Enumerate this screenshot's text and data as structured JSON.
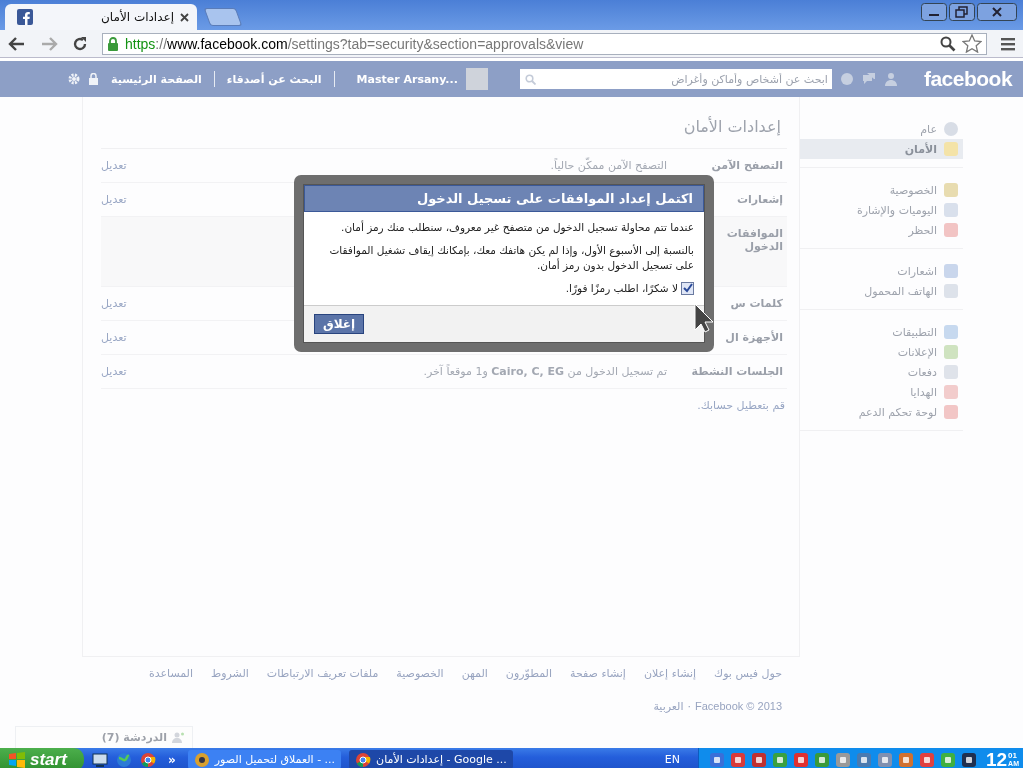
{
  "browser": {
    "tab": {
      "title": "إعدادات الأمان",
      "selected": true
    },
    "address": {
      "scheme": "https",
      "separator": "://",
      "host": "www.facebook.com",
      "path": "/settings?tab=security&section=approvals&view"
    }
  },
  "topbar": {
    "logo": "facebook",
    "search": {
      "placeholder": "ابحث عن أشخاص وأماكن وأغراض"
    },
    "user": "Master Arsany...",
    "links": [
      "البحث عن أصدقاء",
      "الصفحة الرئيسية"
    ]
  },
  "settings": {
    "title": "إعدادات الأمان",
    "rows": [
      {
        "label_lines": [
          "التصفح الآمن"
        ],
        "value": "التصفح الآمن ممكّن حالياً.",
        "action": "تعديل",
        "expanded": false
      },
      {
        "label_lines": [
          "إشعارات"
        ],
        "action": "تعديل",
        "expanded": false
      },
      {
        "label_lines": [
          "الموافقات",
          "الدخول"
        ],
        "expanded": true
      },
      {
        "label_lines": [
          "كلمات س"
        ],
        "action": "تعديل",
        "expanded": false
      },
      {
        "label_lines": [
          "الأجهزة ال"
        ],
        "action": "تعديل",
        "expanded": false
      },
      {
        "label_lines": [
          "الجلسات النشطة"
        ],
        "value": "تم تسجيل الدخول من **Cairo, C, EG** و1 موقعاً آخر.",
        "action": "تعديل",
        "expanded": false
      }
    ],
    "deactivate": "قم بتعطيل حسابك."
  },
  "sidebar": {
    "groups": [
      [
        {
          "label": "عام",
          "selected": false
        },
        {
          "label": "الأمان",
          "selected": true
        }
      ],
      [
        {
          "label": "الخصوصية",
          "selected": false
        },
        {
          "label": "اليوميات والإشارة",
          "selected": false
        },
        {
          "label": "الحظر",
          "selected": false
        }
      ],
      [
        {
          "label": "اشعارات",
          "selected": false
        },
        {
          "label": "الهاتف المحمول",
          "selected": false
        }
      ],
      [
        {
          "label": "التطبيقات",
          "selected": false
        },
        {
          "label": "الإعلانات",
          "selected": false
        },
        {
          "label": "دفعات",
          "selected": false
        },
        {
          "label": "الهدايا",
          "selected": false
        },
        {
          "label": "لوحة تحكم الدعم",
          "selected": false
        }
      ]
    ]
  },
  "footer": {
    "links": [
      "حول فيس بوك",
      "إنشاء إعلان",
      "إنشاء صفحة",
      "المطوّرون",
      "المهن",
      "الخصوصية",
      "ملفات تعريف الارتباطات",
      "الشروط",
      "المساعدة"
    ],
    "copyright": "Facebook © 2013",
    "separator": "·",
    "language": "العربية"
  },
  "chat": {
    "label": "الدردشة (7)"
  },
  "dialog": {
    "title": "اكتمل إعداد الموافقات على تسجيل الدخول",
    "paragraphs": [
      "عندما تتم محاولة تسجيل الدخول من متصفح غير معروف، سنطلب منك رمز أمان.",
      "بالنسبة إلى الأسبوع الأول، وإذا لم يكن هاتفك معك، بإمكانك إيقاف تشغيل الموافقات على تسجيل الدخول بدون رمز أمان."
    ],
    "checkbox": {
      "label": "لا شكرًا، اطلب رمزًا فورًا.",
      "checked": true
    },
    "button": "إغلاق"
  },
  "taskbar": {
    "start": "start",
    "more": "»",
    "tasks": [
      {
        "label": "إعدادات الأمان - Google ...",
        "selected": true
      },
      {
        "label": "العملاق لتحميل الصور - ...",
        "selected": false
      }
    ],
    "language": "EN",
    "clock": {
      "hour": "12",
      "minute": "01",
      "period": "AM"
    }
  }
}
